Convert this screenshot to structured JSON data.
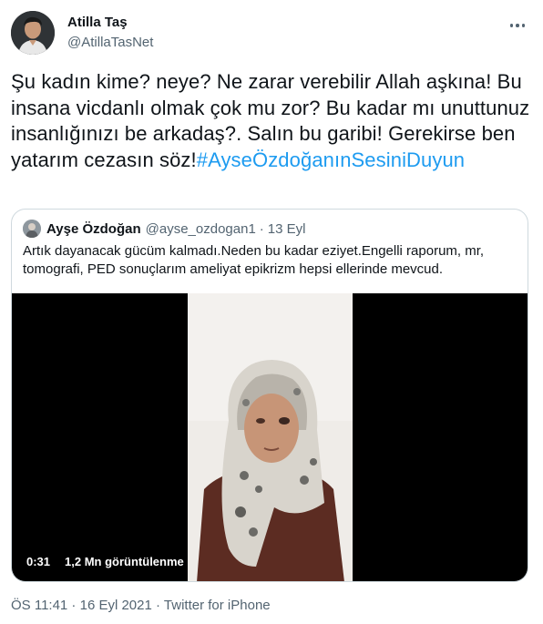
{
  "author": {
    "name": "Atilla Taş",
    "handle": "@AtillaTasNet"
  },
  "tweet": {
    "text": "Şu kadın kime? neye? Ne zarar verebilir Allah aşkına! Bu insana vicdanlı olmak çok mu zor? Bu kadar mı unuttunuz insanlığınızı be arkadaş?. Salın bu garibi! Gerekirse ben yatarım cezasın söz!",
    "hashtag": "#AyseÖzdoğanınSesiniDuyun"
  },
  "quoted": {
    "name": "Ayşe Özdoğan",
    "handle": "@ayse_ozdogan1",
    "separator": "·",
    "date": "13 Eyl",
    "text": "Artık dayanacak gücüm kalmadı.Neden bu kadar eziyet.Engelli raporum, mr, tomografi, PED sonuçlarım ameliyat epikrizm hepsi ellerinde mevcud.",
    "video": {
      "duration": "0:31",
      "views": "1,2 Mn görüntülenme"
    }
  },
  "footer": {
    "time": "ÖS 11:41",
    "sep1": " · ",
    "date": "16 Eyl 2021",
    "sep2": " · ",
    "source": "Twitter for iPhone"
  },
  "colors": {
    "accent": "#1d9bf0",
    "secondary_text": "#536471",
    "border": "#cfd9de"
  },
  "icons": {
    "more": "more-horizontal-icon"
  }
}
